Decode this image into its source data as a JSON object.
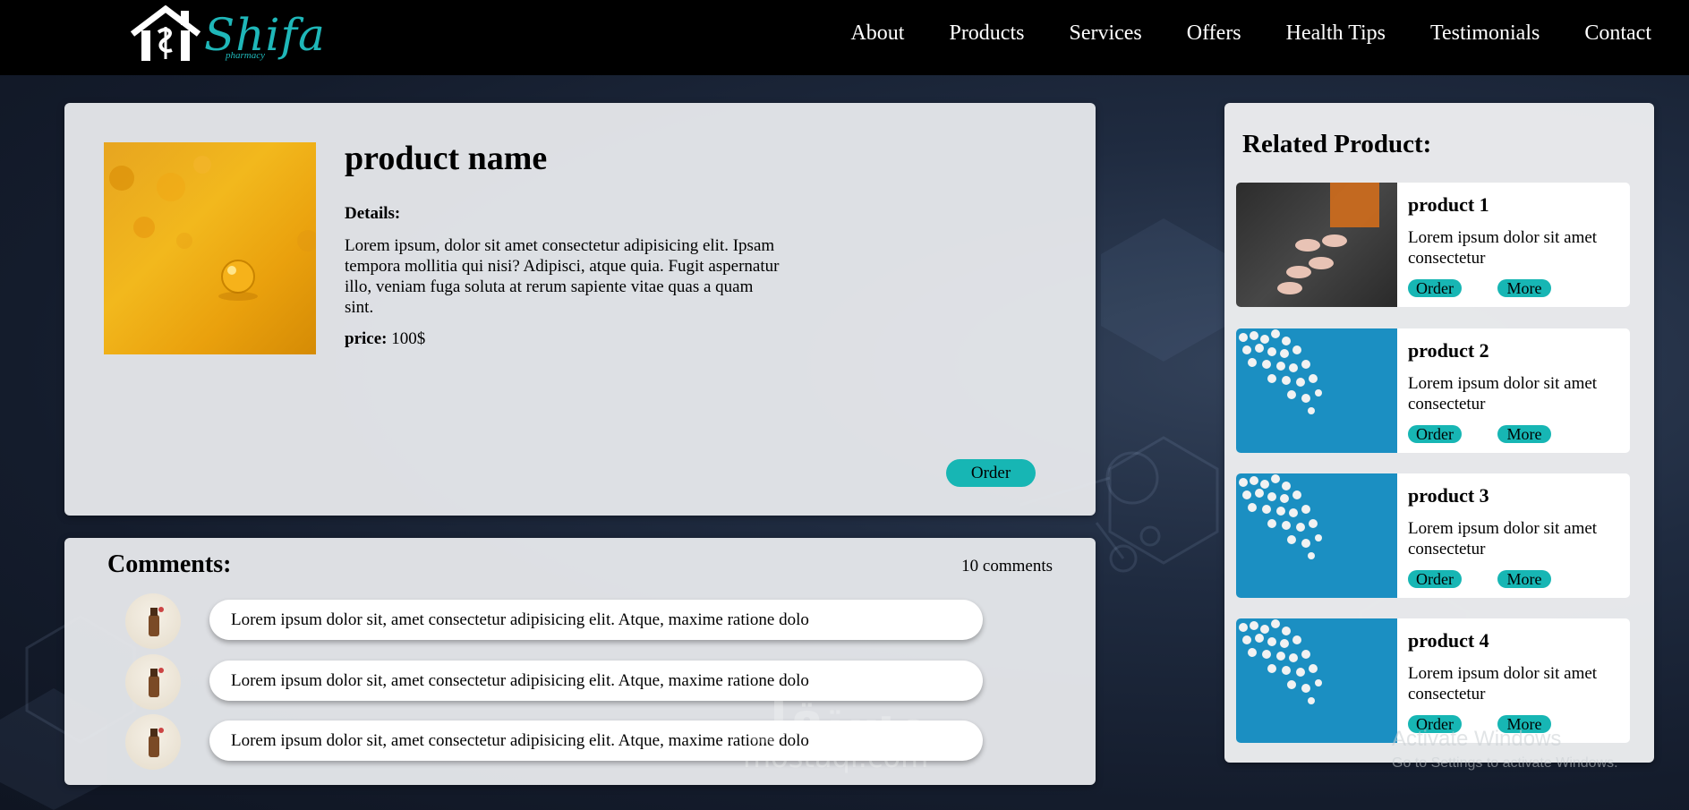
{
  "nav": {
    "logo_text": "Shifa",
    "logo_sub": "pharmacy",
    "links": [
      "About",
      "Products",
      "Services",
      "Offers",
      "Health Tips",
      "Testimonials",
      "Contact"
    ]
  },
  "product": {
    "name": "product name",
    "details_label": "Details:",
    "details_text": "Lorem ipsum, dolor sit amet consectetur adipisicing elit. Ipsam tempora mollitia qui nisi? Adipisci, atque quia. Fugit aspernatur illo, veniam fuga soluta at rerum sapiente vitae quas a quam sint.",
    "price_label": "price:",
    "price_value": "100$",
    "order_label": "Order"
  },
  "comments": {
    "title": "Comments:",
    "count": "10 comments",
    "items": [
      {
        "text": "Lorem ipsum dolor sit, amet consectetur adipisicing elit. Atque, maxime ratione dolo"
      },
      {
        "text": "Lorem ipsum dolor sit, amet consectetur adipisicing elit. Atque, maxime ratione dolo"
      },
      {
        "text": "Lorem ipsum dolor sit, amet consectetur adipisicing elit. Atque, maxime ratione dolo"
      }
    ]
  },
  "related": {
    "title": "Related Product:",
    "items": [
      {
        "name": "product 1",
        "desc": "Lorem ipsum dolor sit amet consectetur",
        "order": "Order",
        "more": "More"
      },
      {
        "name": "product 2",
        "desc": "Lorem ipsum dolor sit amet consectetur",
        "order": "Order",
        "more": "More"
      },
      {
        "name": "product 3",
        "desc": "Lorem ipsum dolor sit amet consectetur",
        "order": "Order",
        "more": "More"
      },
      {
        "name": "product 4",
        "desc": "Lorem ipsum dolor sit amet consectetur",
        "order": "Order",
        "more": "More"
      }
    ]
  },
  "overlays": {
    "activate_title": "Activate Windows",
    "activate_sub": "Go to Settings to activate Windows.",
    "mostaql_ar": "مستقل",
    "mostaql_en": "mostaql.com"
  },
  "colors": {
    "accent": "#17b6b4",
    "navbar": "#000000",
    "logo": "#1fb7b9"
  }
}
